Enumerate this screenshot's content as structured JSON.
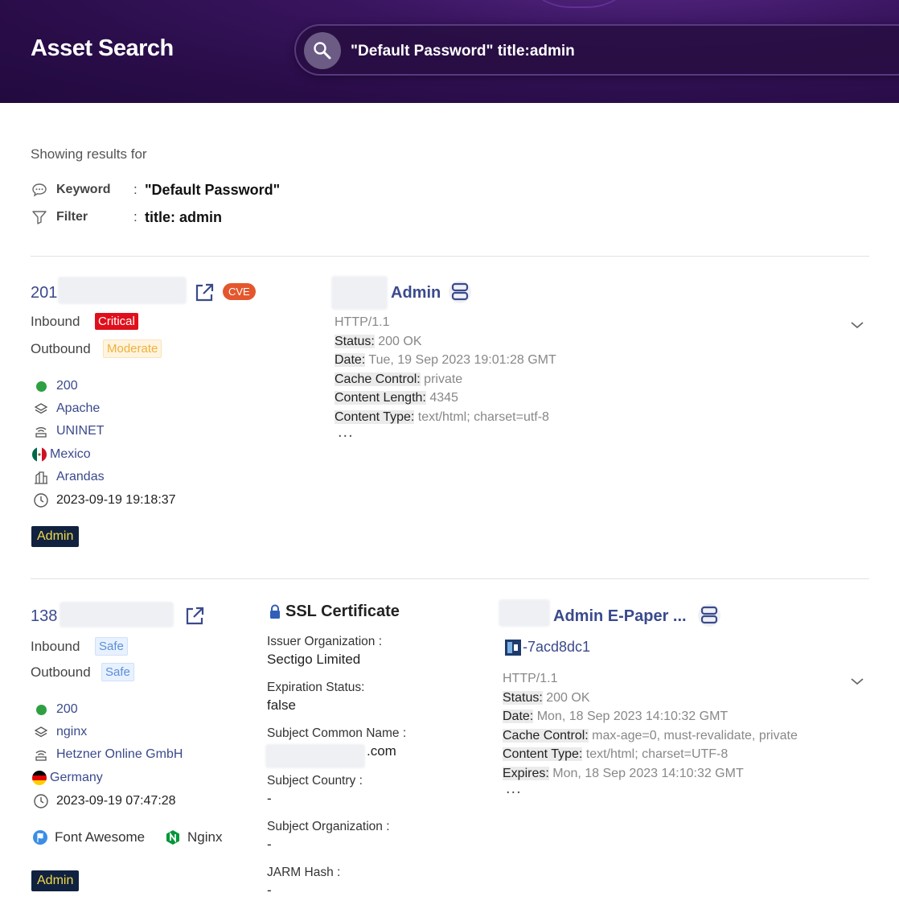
{
  "header": {
    "title": "Asset Search",
    "query": "\"Default Password\" title:admin"
  },
  "criteria": {
    "showing": "Showing results for",
    "keyword_label": "Keyword",
    "keyword_value": "\"Default Password\"",
    "filter_label": "Filter",
    "filter_value": "title: admin"
  },
  "results": [
    {
      "ip_prefix": "201",
      "cve": "CVE",
      "inbound_label": "Inbound",
      "inbound_risk": "Critical",
      "outbound_label": "Outbound",
      "outbound_risk": "Moderate",
      "status": "200",
      "server": "Apache",
      "isp": "UNINET",
      "country": "Mexico",
      "city": "Arandas",
      "timestamp": "2023-09-19 19:18:37",
      "tag": "Admin",
      "service_title": "Admin",
      "http": {
        "protocol": "HTTP/1.1",
        "headers": [
          {
            "k": "Status:",
            "v": " 200 OK"
          },
          {
            "k": "Date:",
            "v": " Tue, 19 Sep 2023 19:01:28 GMT"
          },
          {
            "k": "Cache Control:",
            "v": " private"
          },
          {
            "k": "Content Length:",
            "v": " 4345"
          },
          {
            "k": "Content Type:",
            "v": " text/html; charset=utf-8"
          }
        ],
        "more": "..."
      }
    },
    {
      "ip_prefix": "138",
      "inbound_label": "Inbound",
      "inbound_risk": "Safe",
      "outbound_label": "Outbound",
      "outbound_risk": "Safe",
      "status": "200",
      "server": "nginx",
      "isp": "Hetzner Online GmbH",
      "country": "Germany",
      "timestamp": "2023-09-19 07:47:28",
      "tech1": "Font Awesome",
      "tech2": "Nginx",
      "tag": "Admin",
      "ssl": {
        "title": "SSL Certificate",
        "issuer_label": "Issuer Organization :",
        "issuer_value": "Sectigo Limited",
        "expiration_label": "Expiration Status:",
        "expiration_value": "false",
        "cn_label": "Subject Common Name :",
        "cn_value": ".com",
        "country_label": "Subject Country :",
        "country_value": "-",
        "org_label": "Subject Organization :",
        "org_value": "-",
        "jarm_label": "JARM Hash :",
        "jarm_value": "-"
      },
      "service_title": "Admin E-Paper ...",
      "favicon_hash": "-7acd8dc1",
      "http": {
        "protocol": "HTTP/1.1",
        "headers": [
          {
            "k": "Status:",
            "v": " 200 OK"
          },
          {
            "k": "Date:",
            "v": " Mon, 18 Sep 2023 14:10:32 GMT"
          },
          {
            "k": "Cache Control:",
            "v": " max-age=0, must-revalidate, private"
          },
          {
            "k": "Content Type:",
            "v": " text/html; charset=UTF-8"
          },
          {
            "k": "Expires:",
            "v": " Mon, 18 Sep 2023 14:10:32 GMT"
          }
        ],
        "more": "..."
      }
    }
  ]
}
